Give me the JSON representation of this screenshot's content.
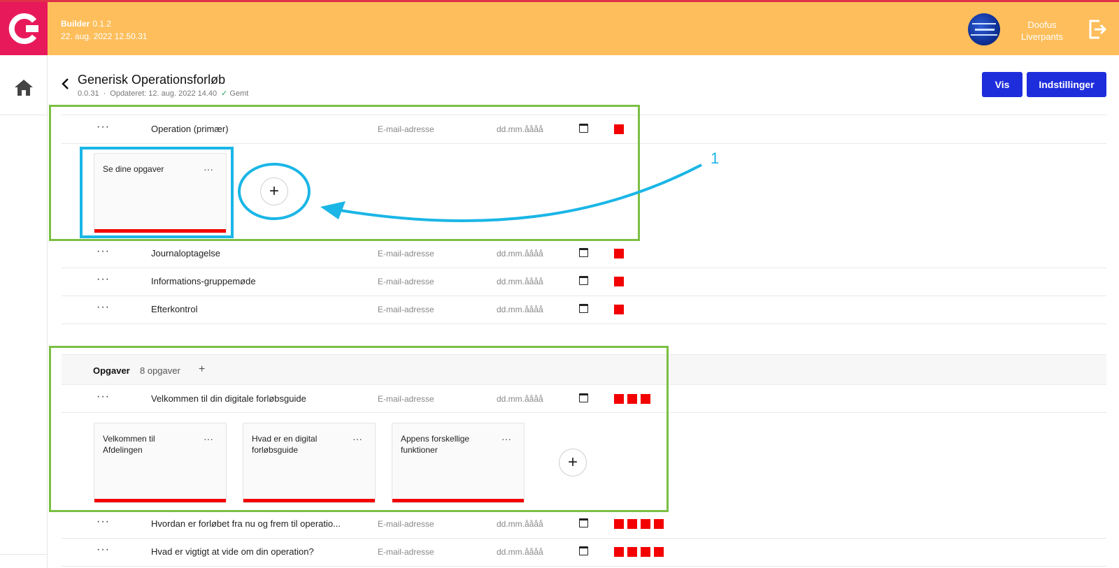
{
  "header": {
    "app_name": "Builder",
    "app_version": "0.1.2",
    "app_date": "22. aug. 2022 12.50.31",
    "user_name_line1": "Doofus",
    "user_name_line2": "Liverpants"
  },
  "page": {
    "title": "Generisk Operationsforløb",
    "version": "0.0.31",
    "updated": "Opdateret: 12. aug. 2022 14.40",
    "saved": "Gemt",
    "btn_vis": "Vis",
    "btn_settings": "Indstillinger"
  },
  "rows": [
    {
      "name": "Operation (primær)",
      "email": "E-mail-adresse",
      "date": "dd.mm.åååå",
      "menu": "···"
    },
    {
      "name": "Journaloptagelse",
      "email": "E-mail-adresse",
      "date": "dd.mm.åååå",
      "menu": "···"
    },
    {
      "name": "Informations-gruppemøde",
      "email": "E-mail-adresse",
      "date": "dd.mm.åååå",
      "menu": "···"
    },
    {
      "name": "Efterkontrol",
      "email": "E-mail-adresse",
      "date": "dd.mm.åååå",
      "menu": "···"
    },
    {
      "name": "Velkommen til din digitale forløbsguide",
      "email": "E-mail-adresse",
      "date": "dd.mm.åååå",
      "menu": "···"
    },
    {
      "name": "Hvordan er forløbet fra nu og frem til operatio...",
      "email": "E-mail-adresse",
      "date": "dd.mm.åååå",
      "menu": "···"
    },
    {
      "name": "Hvad er vigtigt at vide om din operation?",
      "email": "E-mail-adresse",
      "date": "dd.mm.åååå",
      "menu": "···"
    }
  ],
  "cards_top": [
    {
      "title": "Se dine opgaver",
      "menu": "···"
    }
  ],
  "section": {
    "title": "Opgaver",
    "count": "8 opgaver",
    "add": "+"
  },
  "cards_bottom": [
    {
      "title": "Velkommen til Afdelingen",
      "menu": "···"
    },
    {
      "title": "Hvad er en digital forløbsguide",
      "menu": "···"
    },
    {
      "title": "Appens forskellige funktioner",
      "menu": "···"
    }
  ],
  "plus": "+",
  "annotation": {
    "label": "1"
  },
  "colors": {
    "accent": "#1e2ddc",
    "header": "#fdbe5b",
    "brand": "#e8195a",
    "status": "#f30000",
    "highlight_green": "#7bbf44",
    "highlight_cyan": "#1ab6e6"
  },
  "status_squares": [
    1,
    1,
    1,
    1,
    3,
    4,
    4
  ]
}
